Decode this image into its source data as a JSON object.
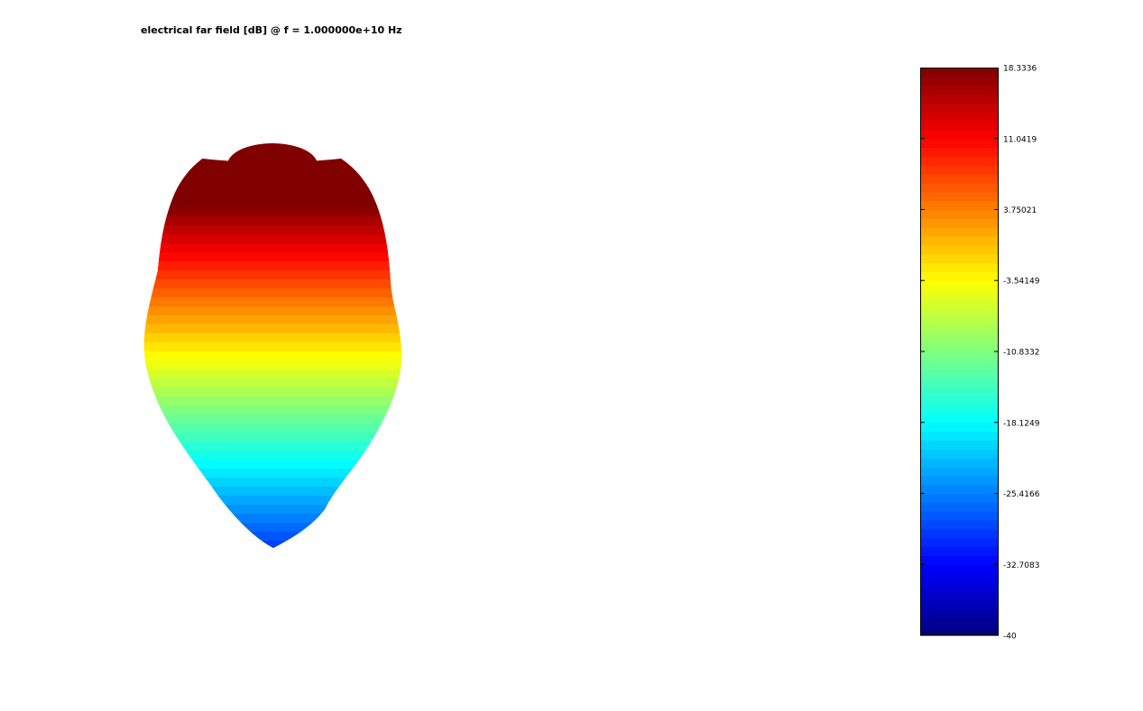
{
  "chart_data": {
    "type": "heatmap",
    "title": "electrical far field [dB] @ f = 1.000000e+10 Hz",
    "plot_kind": "3D far-field radiation pattern surface",
    "colormap": "jet",
    "color_range": [
      -40,
      18.3336
    ],
    "colorbar": {
      "position": "right",
      "tick_values": [
        18.3336,
        11.0419,
        3.75021,
        -3.54149,
        -10.8332,
        -18.1249,
        -25.4166,
        -32.7083,
        -40
      ],
      "tick_labels": [
        "18.3336",
        "11.0419",
        "3.75021",
        "-3.54149",
        "-10.8332",
        "-18.1249",
        "-25.4166",
        "-32.7083",
        "-40"
      ]
    },
    "pattern": {
      "max_db": 18.3336,
      "min_db": -40,
      "main_lobe_direction": "up",
      "shape": "single directive main lobe (pear-shaped surface)"
    }
  }
}
